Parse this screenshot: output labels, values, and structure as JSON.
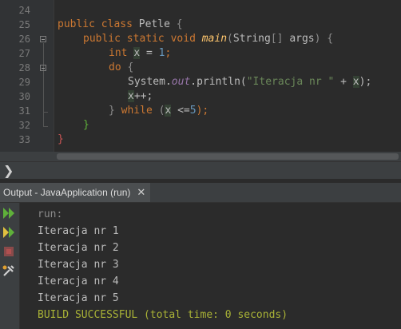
{
  "editor": {
    "line_numbers": [
      "24",
      "25",
      "26",
      "27",
      "28",
      "29",
      "30",
      "31",
      "32",
      "33"
    ],
    "lines": {
      "l25": {
        "kw1": "public",
        "kw2": "class",
        "name": "Petle",
        "brace": "{"
      },
      "l26": {
        "kw1": "public",
        "kw2": "static",
        "kw3": "void",
        "method": "main",
        "open": "(",
        "type": "String",
        "arr": "[]",
        "param": "args",
        ")": ")",
        "brace": "{"
      },
      "l27": {
        "kw": "int",
        "var": "x",
        "rest1": " = ",
        "num": "1",
        "semi": ";"
      },
      "l28": {
        "kw": "do",
        "brace": "{"
      },
      "l29": {
        "cls": "System.",
        "field": "out",
        "call": ".println(",
        "str": "\"Iteracja nr \"",
        "plus": " + ",
        "var": "x",
        "end": ");"
      },
      "l30": {
        "var": "x",
        "rest": "++;"
      },
      "l31": {
        "brace": "}",
        "kw": "while",
        "open": "(",
        "var": "x",
        "cond": " <=",
        "num": "5",
        "end": ");"
      },
      "l32": {
        "brace": "}"
      },
      "l33": {
        "brace": "}"
      }
    }
  },
  "navbar": {
    "arrow_icon": "chevron-right-icon"
  },
  "output_tab": {
    "label": "Output - JavaApplication (run)",
    "close": "✕"
  },
  "output": {
    "lines": [
      "run:",
      "Iteracja nr 1",
      "Iteracja nr 2",
      "Iteracja nr 3",
      "Iteracja nr 4",
      "Iteracja nr 5",
      "BUILD SUCCESSFUL (total time: 0 seconds)"
    ]
  },
  "colors": {
    "success": "#a9b236",
    "run_muted": "#8a8a8a",
    "run_icon": "#5fb03a",
    "stop_icon": "#b05050"
  }
}
